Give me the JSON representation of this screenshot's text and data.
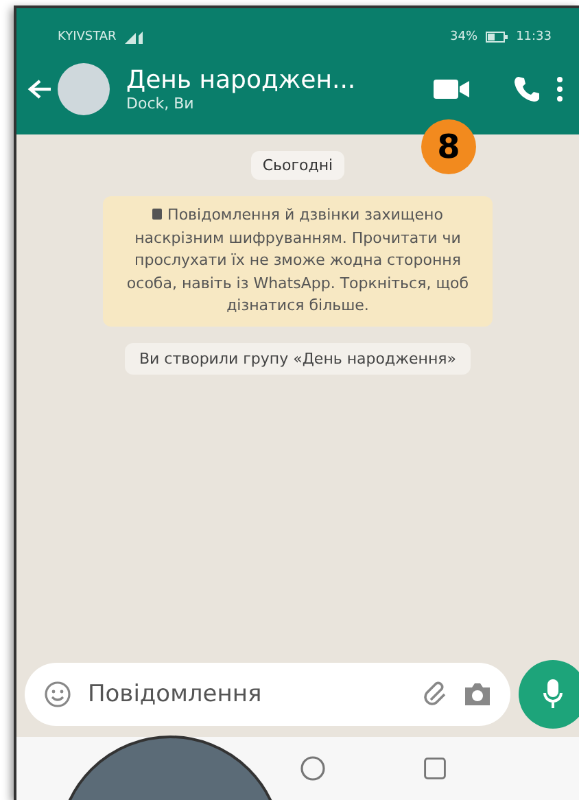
{
  "status_bar": {
    "carrier": "KYIVSTAR",
    "battery": "34%",
    "time": "11:33"
  },
  "header": {
    "title": "День народжен...",
    "subtitle": "Dock, Ви"
  },
  "callout": {
    "number": "8"
  },
  "date_chip": "Сьогодні",
  "messages": [
    {
      "kind": "notice",
      "text": "Повідомлення й дзвінки захищено наскрізним шифруванням. Прочитати чи прослухати їх не зможе жодна стороння особа, навіть із WhatsApp. Торкніться, щоб дізнатися більше."
    },
    {
      "kind": "system",
      "text": "Ви створили групу «День народження»"
    }
  ],
  "composer": {
    "placeholder": "Повідомлення"
  }
}
